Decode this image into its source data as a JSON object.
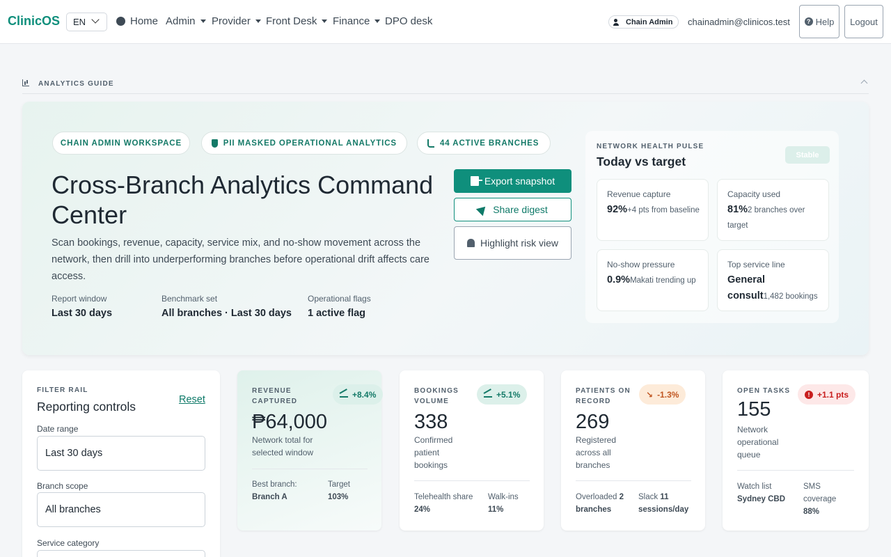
{
  "app": {
    "brand": "ClinicOS",
    "language": "EN"
  },
  "nav": {
    "home": "Home",
    "admin": "Admin",
    "provider": "Provider",
    "front_desk": "Front Desk",
    "finance": "Finance",
    "dpo_desk": "DPO desk"
  },
  "user": {
    "role": "Chain Admin",
    "email": "chainadmin@clinicos.test",
    "help": "Help",
    "logout": "Logout"
  },
  "guide": {
    "label": "ANALYTICS GUIDE"
  },
  "hero": {
    "pills": [
      "CHAIN ADMIN WORKSPACE",
      "PII MASKED OPERATIONAL ANALYTICS",
      "44 ACTIVE BRANCHES"
    ],
    "title": "Cross-Branch Analytics Command Center",
    "description": "Scan bookings, revenue, capacity, service mix, and no-show movement across the network, then drill into underperforming branches before operational drift affects care access.",
    "meta": [
      {
        "label": "Report window",
        "value": "Last 30 days"
      },
      {
        "label": "Benchmark set",
        "value": "All branches · Last 30 days"
      },
      {
        "label": "Operational flags",
        "value": "1 active flag"
      }
    ],
    "actions": {
      "export": "Export snapshot",
      "share": "Share digest",
      "risk": "Highlight risk view"
    }
  },
  "pulse": {
    "eyebrow": "NETWORK HEALTH PULSE",
    "title": "Today vs target",
    "status": "Stable",
    "cards": [
      {
        "label": "Revenue capture",
        "big": "92%",
        "detail": "+4 pts from baseline"
      },
      {
        "label": "Capacity used",
        "big": "81%",
        "detail": "2 branches over target"
      },
      {
        "label": "No-show pressure",
        "big": "0.9%",
        "detail": "Makati trending up"
      },
      {
        "label": "Top service line",
        "big": "General consult",
        "detail": "1,482 bookings"
      }
    ]
  },
  "filters": {
    "eyebrow": "FILTER RAIL",
    "title": "Reporting controls",
    "reset": "Reset",
    "date_label": "Date range",
    "date_value": "Last 30 days",
    "branch_label": "Branch scope",
    "branch_value": "All branches",
    "service_label": "Service category"
  },
  "kpis": {
    "revenue": {
      "eyebrow_1": "REVENUE",
      "eyebrow_2": "CAPTURED",
      "delta": "+8.4%",
      "value": "₱64,000",
      "sub_1": "Network total for",
      "sub_2": "selected window",
      "foot_a_k": "Best branch:",
      "foot_a_v": "Branch A",
      "foot_b_k": "Target",
      "foot_b_v": "103%"
    },
    "bookings": {
      "eyebrow_1": "BOOKINGS",
      "eyebrow_2": "VOLUME",
      "delta": "+5.1%",
      "value": "338",
      "sub_1": "Confirmed",
      "sub_2": "patient",
      "sub_3": "bookings",
      "foot_a_k": "Telehealth share",
      "foot_a_v": "24%",
      "foot_b_k": "Walk-ins",
      "foot_b_v": "11%"
    },
    "patients": {
      "eyebrow_1": "PATIENTS ON",
      "eyebrow_2": "RECORD",
      "delta": "-1.3%",
      "value": "269",
      "sub_1": "Registered",
      "sub_2": "across all",
      "sub_3": "branches",
      "foot_a_k": "Overloaded",
      "foot_a_num": "2",
      "foot_a_v": "branches",
      "foot_b_k": "Slack",
      "foot_b_num": "11",
      "foot_b_v": "sessions/day"
    },
    "tasks": {
      "eyebrow_1": "OPEN TASKS",
      "delta": "+1.1 pts",
      "value": "155",
      "sub_1": "Network",
      "sub_2": "operational",
      "sub_3": "queue",
      "foot_a_k": "Watch list",
      "foot_a_v": "Sydney CBD",
      "foot_b_k": "SMS",
      "foot_b_k2": "coverage",
      "foot_b_v": "88%"
    }
  },
  "colors": {
    "accent": "#0f8f7c",
    "accent_dark": "#157a68",
    "warn": "#c05621",
    "danger": "#c81e1e"
  }
}
